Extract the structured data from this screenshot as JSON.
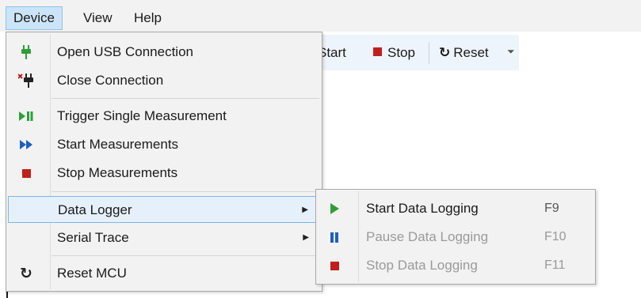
{
  "menubar": {
    "items": [
      {
        "label": "Device",
        "active": true
      },
      {
        "label": "View"
      },
      {
        "label": "Help"
      }
    ]
  },
  "toolbar": {
    "start_label": "Start",
    "stop_label": "Stop",
    "reset_label": "Reset",
    "reset_glyph": "↻",
    "overflow_glyph": "⏷"
  },
  "device_menu": {
    "items": [
      {
        "label": "Open USB Connection",
        "icon": "usb-plug-icon"
      },
      {
        "label": "Close Connection",
        "icon": "usb-disconnect-icon"
      },
      {
        "label": "Trigger Single Measurement",
        "icon": "play-pause-icon"
      },
      {
        "label": "Start Measurements",
        "icon": "fast-forward-icon"
      },
      {
        "label": "Stop Measurements",
        "icon": "stop-icon"
      },
      {
        "label": "Data Logger",
        "has_submenu": true,
        "highlighted": true
      },
      {
        "label": "Serial Trace",
        "has_submenu": true
      },
      {
        "label": "Reset MCU",
        "icon": "reset-icon"
      }
    ],
    "submenu_arrow": "▶",
    "icon_glyphs": {
      "play_pause": "▶❚❚",
      "fast_forward": "▶▶",
      "reset": "↻",
      "close_x": "×"
    }
  },
  "data_logger_submenu": {
    "items": [
      {
        "label": "Start Data Logging",
        "shortcut": "F9",
        "enabled": true,
        "icon": "play-icon"
      },
      {
        "label": "Pause Data Logging",
        "shortcut": "F10",
        "enabled": false,
        "icon": "pause-icon"
      },
      {
        "label": "Stop Data Logging",
        "shortcut": "F11",
        "enabled": false,
        "icon": "stop-icon"
      }
    ]
  },
  "colors": {
    "menu_background": "#f2f2f2",
    "highlight_background": "#e6f0fa",
    "highlight_border": "#7eb4ea",
    "active_menubar_background": "#cce4f7",
    "icon_green": "#2e9e3a",
    "icon_blue": "#1f5fbf",
    "icon_red": "#c0201c",
    "disabled_text": "#9a9a9a"
  }
}
